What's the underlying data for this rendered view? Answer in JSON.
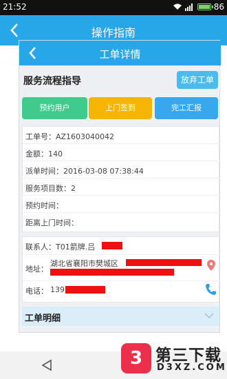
{
  "status_bar": {
    "time": "21:52",
    "battery": "86"
  },
  "top_bar": {
    "title": "操作指南"
  },
  "inner_bar": {
    "title": "工单详情"
  },
  "guide": {
    "label": "服务流程指导",
    "abandon_label": "放弃工单"
  },
  "actions": {
    "book": "预约用户",
    "signin": "上门签到",
    "report": "完工汇报"
  },
  "order": {
    "rows": [
      "工单号：AZ1603040042",
      "金额：140",
      "派单时间：2016-03-08 07:38:44",
      "服务项目数：2",
      "预约时间：",
      "距离上门时间："
    ]
  },
  "contact": {
    "name": "联系人：T01箭牌.吕",
    "address_label": "地址：",
    "address_value": "湖北省襄阳市樊城区",
    "phone_label": "电话：",
    "phone_value": "139"
  },
  "detail": {
    "label": "工单明细"
  },
  "watermark": {
    "title": "第三下载",
    "sub": "D3XZ.COM",
    "logo_char": "3"
  },
  "colors": {
    "accent": "#27a6e8",
    "book": "#3ecb8b",
    "signin": "#f4b600",
    "report": "#38a8ee",
    "redaction": "#ee1010"
  }
}
